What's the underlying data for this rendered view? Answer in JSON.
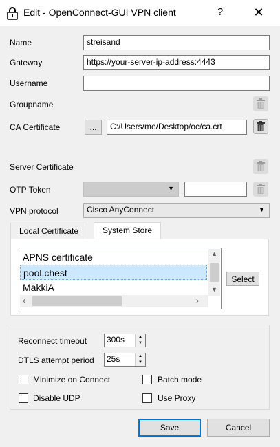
{
  "window": {
    "title": "Edit - OpenConnect-GUI VPN client",
    "help_glyph": "?",
    "close_glyph": "✕"
  },
  "form": {
    "name_label": "Name",
    "name_value": "streisand",
    "gateway_label": "Gateway",
    "gateway_value": "https://your-server-ip-address:4443",
    "username_label": "Username",
    "username_value": "",
    "groupname_label": "Groupname",
    "ca_label": "CA Certificate",
    "ca_browse": "...",
    "ca_value": "C:/Users/me/Desktop/oc/ca.crt",
    "server_cert_label": "Server Certificate",
    "otp_label": "OTP Token",
    "otp_type": "",
    "otp_value": "",
    "protocol_label": "VPN protocol",
    "protocol_value": "Cisco AnyConnect"
  },
  "certs": {
    "tabs": [
      {
        "label": "Local Certificate"
      },
      {
        "label": "System Store"
      }
    ],
    "active_tab": "System Store",
    "items": [
      {
        "label": "APNS certificate"
      },
      {
        "label": "pool.chest"
      },
      {
        "label": "MakkiA"
      }
    ],
    "selected": "pool.chest",
    "select_button": "Select"
  },
  "options": {
    "reconnect_label": "Reconnect timeout",
    "reconnect_value": "300s",
    "dtls_label": "DTLS attempt period",
    "dtls_value": "25s",
    "checkboxes": [
      {
        "label": "Minimize on Connect",
        "checked": false
      },
      {
        "label": "Batch mode",
        "checked": false
      },
      {
        "label": "Disable UDP",
        "checked": false
      },
      {
        "label": "Use Proxy",
        "checked": false
      }
    ]
  },
  "footer": {
    "save": "Save",
    "cancel": "Cancel"
  },
  "colors": {
    "accent": "#0078d7",
    "selection": "#cce8ff"
  }
}
